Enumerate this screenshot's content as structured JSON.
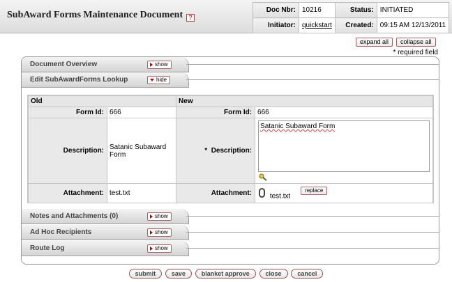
{
  "header": {
    "title": "SubAward Forms Maintenance Document",
    "help_glyph": "?",
    "doc_nbr_label": "Doc Nbr:",
    "doc_nbr": "10216",
    "status_label": "Status:",
    "status": "INITIATED",
    "initiator_label": "Initiator:",
    "initiator": "quickstart",
    "created_label": "Created:",
    "created": "09:15 AM 12/13/2011"
  },
  "controls": {
    "expand_all": "expand all",
    "collapse_all": "collapse all",
    "required_note": "* required field"
  },
  "tabs": [
    {
      "title": "Document Overview",
      "button": "show"
    },
    {
      "title": "Edit SubAwardForms Lookup",
      "button": "hide"
    },
    {
      "title": "Notes and Attachments (0)",
      "button": "show"
    },
    {
      "title": "Ad Hoc Recipients",
      "button": "show"
    },
    {
      "title": "Route Log",
      "button": "show"
    }
  ],
  "edit": {
    "old_header": "Old",
    "new_header": "New",
    "form_id_label": "Form Id:",
    "old_form_id": "666",
    "new_form_id": "666",
    "description_label": "Description:",
    "required_marker": "*",
    "old_description": "Satanic Subaward Form",
    "new_description": "Satanic Subaward Form",
    "attachment_label": "Attachment:",
    "old_attachment": "test.txt",
    "new_attachment": "test.txt",
    "replace_button": "replace"
  },
  "actions": [
    "submit",
    "save",
    "blanket approve",
    "close",
    "cancel"
  ],
  "icons": {
    "help": "help-icon",
    "lookup": "lookup-icon",
    "attachment": "paperclip-icon",
    "expand": "arrow-right-icon",
    "collapse": "arrow-down-icon"
  },
  "colors": {
    "button_border": "#b06060",
    "arrow": "#b00000"
  }
}
